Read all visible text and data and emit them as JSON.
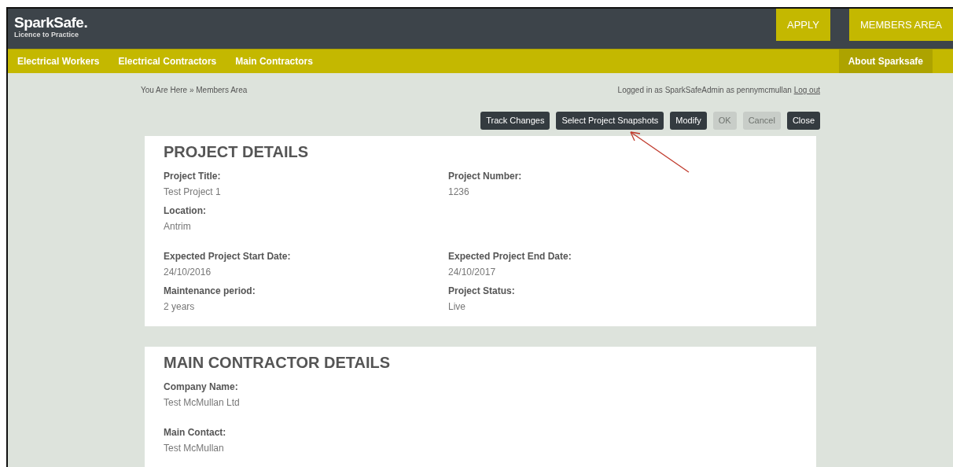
{
  "header": {
    "logo": "SparkSafe",
    "logo_dot": ".",
    "tagline": "Licence to Practice",
    "actions": [
      "APPLY",
      "MEMBERS AREA"
    ]
  },
  "nav": [
    {
      "label": "Electrical Workers",
      "kind": "left",
      "selected": false
    },
    {
      "label": "Electrical Contractors",
      "kind": "left",
      "selected": false
    },
    {
      "label": "Main Contractors",
      "kind": "left",
      "selected": false
    },
    {
      "label": "About Sparksafe",
      "kind": "right",
      "selected": true
    }
  ],
  "breadcrumb": "You Are Here » Members Area",
  "login": {
    "text": "Logged in as SparkSafeAdmin as pennymcmullan",
    "link": "Log out"
  },
  "buttons": [
    {
      "label": "Track Changes",
      "disabled": false
    },
    {
      "label": "Select Project Snapshots",
      "disabled": false
    },
    {
      "label": "Modify",
      "disabled": false
    },
    {
      "label": "OK",
      "disabled": true
    },
    {
      "label": "Cancel",
      "disabled": true
    },
    {
      "label": "Close",
      "disabled": false
    }
  ],
  "sections": [
    {
      "title": "PROJECT DETAILS",
      "groups": [
        [
          {
            "fields": [
              {
                "label": "Project Title:",
                "value": "Test Project 1"
              },
              {
                "label": "Project Number:",
                "value": "1236"
              }
            ]
          },
          {
            "fields": [
              {
                "label": "Location:",
                "value": "Antrim"
              }
            ]
          }
        ],
        [
          {
            "fields": [
              {
                "label": "Expected Project Start Date:",
                "value": "24/10/2016"
              },
              {
                "label": "Expected Project End Date:",
                "value": "24/10/2017"
              }
            ]
          },
          {
            "fields": [
              {
                "label": "Maintenance period:",
                "value": "2 years"
              },
              {
                "label": "Project Status:",
                "value": "Live"
              }
            ]
          }
        ]
      ]
    },
    {
      "title": "MAIN CONTRACTOR DETAILS",
      "groups": [
        [
          {
            "fields": [
              {
                "label": "Company Name:",
                "value": "Test McMullan Ltd"
              }
            ]
          }
        ],
        [
          {
            "fields": [
              {
                "label": "Main Contact:",
                "value": "Test McMullan"
              }
            ]
          }
        ]
      ]
    }
  ]
}
